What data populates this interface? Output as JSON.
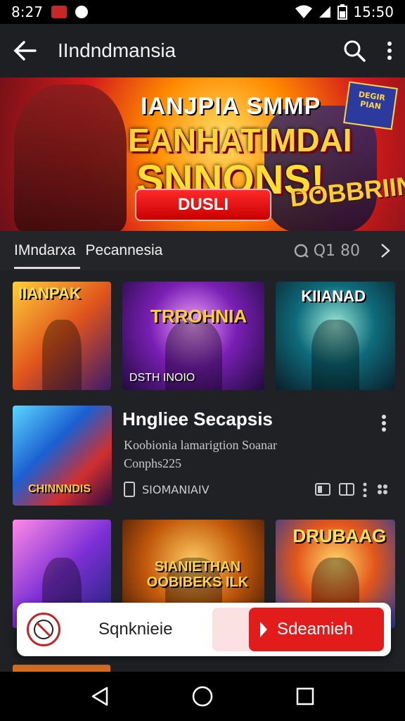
{
  "status_bar": {
    "time": "8:27",
    "battery_time": "15:50"
  },
  "app_bar": {
    "title": "IIndndmansia"
  },
  "banner": {
    "line1": "IANJPIA SMMP",
    "line2": "EANHATIMDAI",
    "line3": "SNNONS!",
    "cta": "DUSLI",
    "logo_right": "DOBBRIINS",
    "tag_right": "DEGIR PIAN"
  },
  "tabs": {
    "active": "IMndarxa",
    "second": "Pecannesia",
    "count": "Q1 80"
  },
  "row1": [
    {
      "caption": "IIANPAK"
    },
    {
      "caption": "TRROHNIA",
      "footer": "DSTH   INOIO"
    },
    {
      "caption": "KIIANAD"
    }
  ],
  "detail": {
    "thumb_caption": "CHINNNDIS",
    "title": "Hngliee Secapsis",
    "subtitle": "Koobionia lamarigtion Soanar",
    "subtitle2": "Conphs225",
    "meta": "SIOMANIAIV"
  },
  "row2": [
    {
      "caption": ""
    },
    {
      "caption": "SIANIETHAN OOBIBEKS ILK"
    },
    {
      "caption": "DRUBAAG"
    }
  ],
  "bottom_card": {
    "label": "Sqnknieie",
    "button": "Sdeamieh"
  },
  "colors": {
    "accent": "#e21b1b",
    "background": "#1f2125"
  }
}
